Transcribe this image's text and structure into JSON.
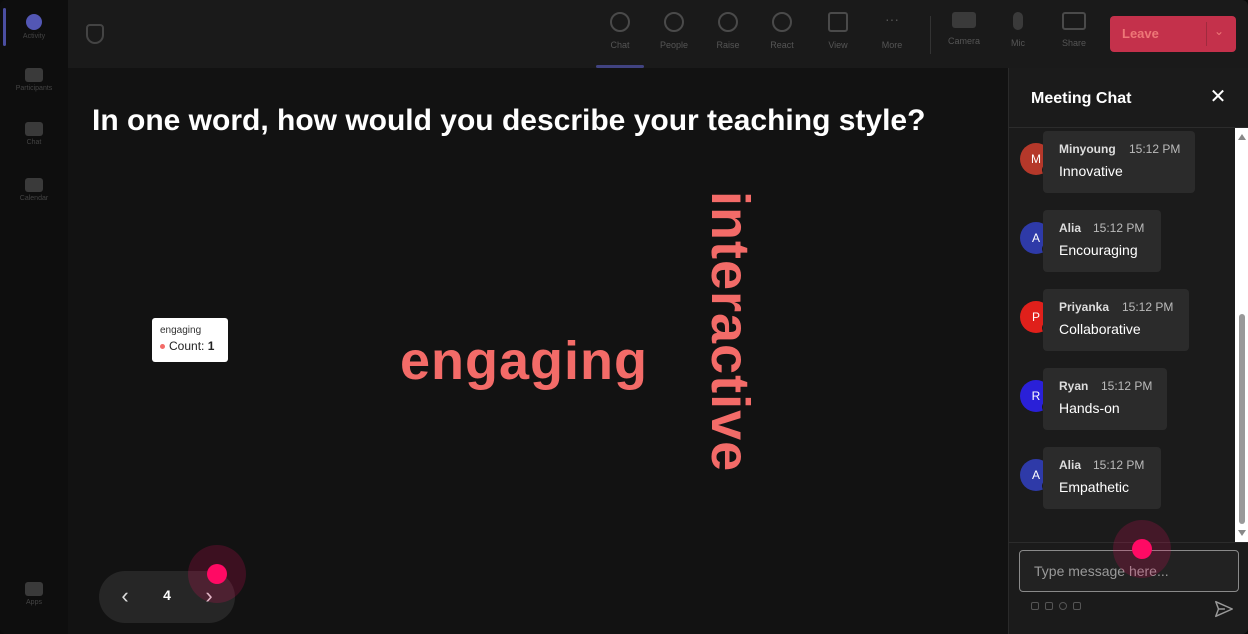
{
  "rail": {
    "items": [
      {
        "label": "Activity",
        "active": true
      },
      {
        "label": "Participants"
      },
      {
        "label": "Chat"
      },
      {
        "label": "Calendar"
      },
      {
        "label": "Apps"
      }
    ]
  },
  "toolbar": {
    "tools": [
      {
        "id": "chat",
        "label": "Chat",
        "icon": "chat-icon",
        "active": true
      },
      {
        "id": "people",
        "label": "People",
        "icon": "people-icon"
      },
      {
        "id": "raise",
        "label": "Raise",
        "icon": "hand-icon"
      },
      {
        "id": "react",
        "label": "React",
        "icon": "emoji-icon"
      },
      {
        "id": "view",
        "label": "View",
        "icon": "grid-icon"
      },
      {
        "id": "more",
        "label": "More",
        "icon": "more-icon"
      },
      {
        "id": "camera",
        "label": "Camera",
        "icon": "camera-icon"
      },
      {
        "id": "mic",
        "label": "Mic",
        "icon": "mic-icon"
      },
      {
        "id": "share",
        "label": "Share",
        "icon": "share-icon"
      }
    ],
    "leave_label": "Leave",
    "leave_color": "#c4314b"
  },
  "stage": {
    "question": "In one word, how would you describe your teaching style?",
    "words": [
      {
        "text": "engaging",
        "orientation": "horizontal"
      },
      {
        "text": "interactive",
        "orientation": "vertical"
      }
    ],
    "word_color": "#f36b68",
    "tooltip": {
      "word": "engaging",
      "count_label": "Count:",
      "count": "1"
    },
    "pager": {
      "page": "4"
    }
  },
  "chat": {
    "title": "Meeting Chat",
    "input_placeholder": "Type message here...",
    "messages": [
      {
        "initial": "M",
        "name": "Minyoung",
        "time": "15:12 PM",
        "text": "Innovative",
        "color": "#b5382a"
      },
      {
        "initial": "A",
        "name": "Alia",
        "time": "15:12 PM",
        "text": "Encouraging",
        "color": "#2e3aa8"
      },
      {
        "initial": "P",
        "name": "Priyanka",
        "time": "15:12 PM",
        "text": "Collaborative",
        "color": "#e0201b"
      },
      {
        "initial": "R",
        "name": "Ryan",
        "time": "15:12 PM",
        "text": "Hands-on",
        "color": "#2a20d8"
      },
      {
        "initial": "A",
        "name": "Alia",
        "time": "15:12 PM",
        "text": "Empathetic",
        "color": "#2e3aa8"
      }
    ]
  }
}
